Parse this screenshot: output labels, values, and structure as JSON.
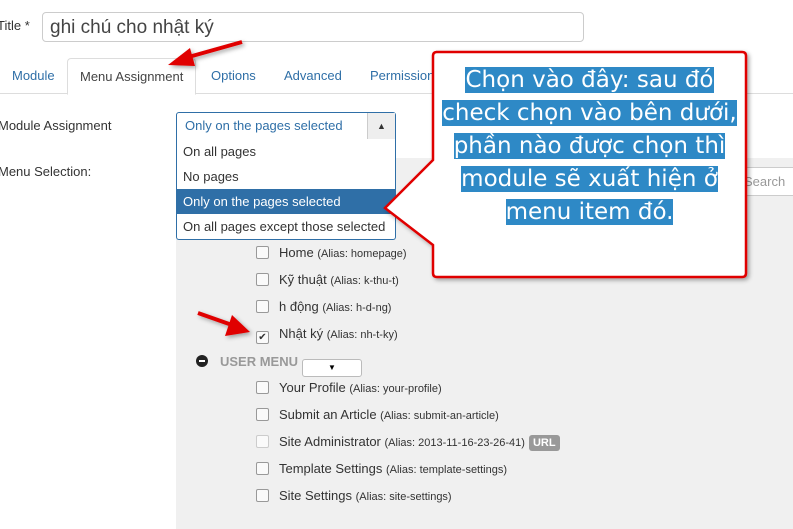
{
  "title": {
    "label": "Title *",
    "value": "ghi chú cho nhật ký"
  },
  "tabs": [
    {
      "label": "Module"
    },
    {
      "label": "Menu Assignment"
    },
    {
      "label": "Options"
    },
    {
      "label": "Advanced"
    },
    {
      "label": "Permission"
    }
  ],
  "module_assignment": {
    "label": "Module Assignment",
    "selected": "Only on the pages selected",
    "options": [
      "On all pages",
      "No pages",
      "Only on the pages selected",
      "On all pages except those selected"
    ]
  },
  "menu_selection": {
    "label": "Menu Selection:",
    "search_placeholder": "Search"
  },
  "main_menu_items": [
    {
      "label": "Home",
      "alias": "(Alias: homepage)",
      "checked": false
    },
    {
      "label": "Kỹ thuật",
      "alias": "(Alias: k-thu-t)",
      "checked": false
    },
    {
      "label": "h động",
      "alias": "(Alias: h-d-ng)",
      "checked": false
    },
    {
      "label": "Nhật ký",
      "alias": "(Alias: nh-t-ky)",
      "checked": true
    }
  ],
  "user_menu": {
    "title": "USER MENU",
    "items": [
      {
        "label": "Your Profile",
        "alias": "(Alias: your-profile)"
      },
      {
        "label": "Submit an Article",
        "alias": "(Alias: submit-an-article)"
      },
      {
        "label": "Site Administrator",
        "alias": "(Alias: 2013-11-16-23-26-41)",
        "badge": "URL",
        "disabled": true
      },
      {
        "label": "Template Settings",
        "alias": "(Alias: template-settings)"
      },
      {
        "label": "Site Settings",
        "alias": "(Alias: site-settings)"
      }
    ]
  },
  "callout": {
    "text": "Chọn vào đây: sau đó check chọn vào bên dưới, phần nào được chọn thì module sẽ xuất hiện ở menu item đó."
  },
  "colors": {
    "accent": "#2f6fa7",
    "annotation": "#e00000",
    "highlight": "#2e89c6"
  }
}
